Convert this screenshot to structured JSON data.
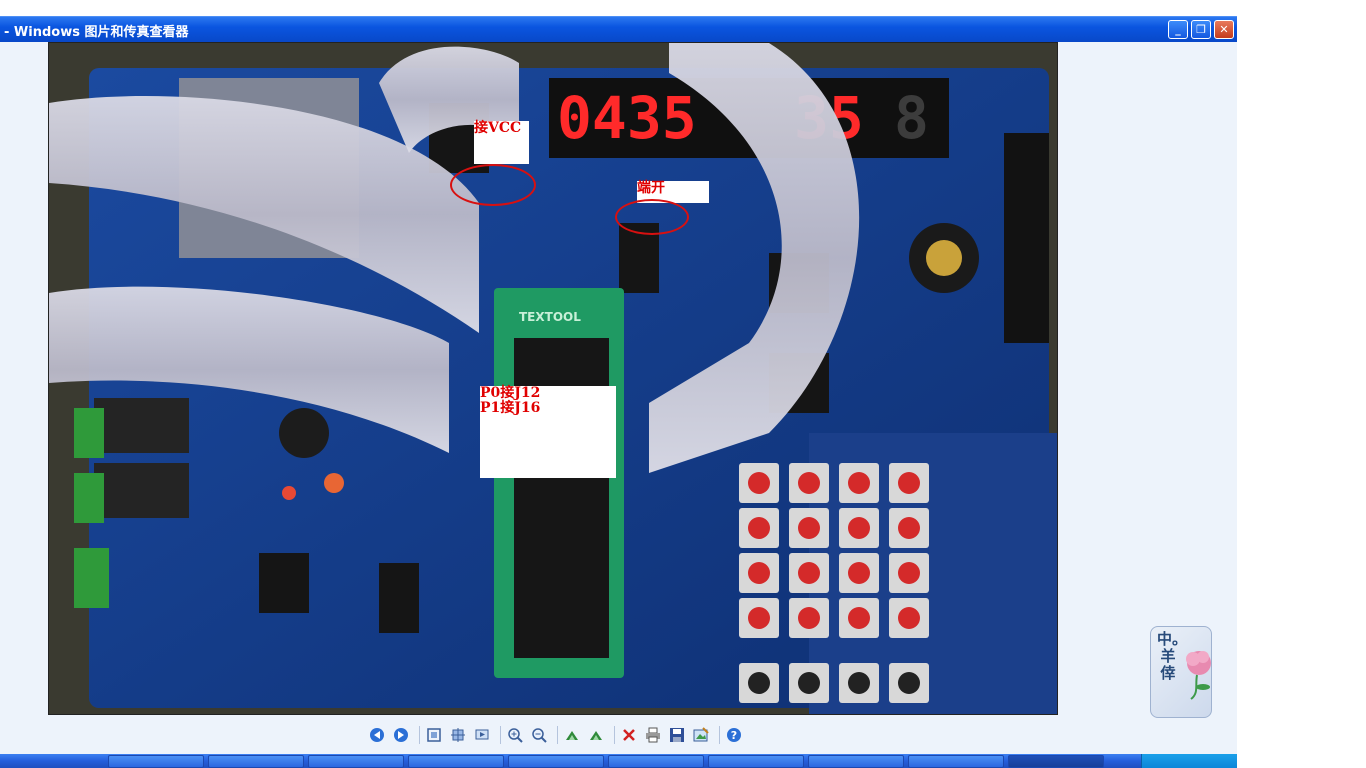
{
  "window": {
    "title": "- Windows 图片和传真查看器",
    "min_icon": "minimize-icon",
    "max_icon": "maximize-icon",
    "close_icon": "close-icon"
  },
  "photo": {
    "description_icon": "development-board-photo",
    "annotations": {
      "vcc": "接VCC",
      "disconnect": "端开",
      "p0": "P0接J12",
      "p1": "P1接J16"
    },
    "board_labels": {
      "seg_left": "0435",
      "seg_right": "35",
      "chip": "TEXTOOL"
    }
  },
  "toolbar": {
    "buttons": [
      {
        "name": "previous-image-button",
        "icon": "prev-icon"
      },
      {
        "name": "next-image-button",
        "icon": "next-icon"
      },
      {
        "name": "best-fit-button",
        "icon": "fit-icon"
      },
      {
        "name": "actual-size-button",
        "icon": "actual-size-icon"
      },
      {
        "name": "slideshow-button",
        "icon": "slideshow-icon"
      },
      {
        "name": "zoom-in-button",
        "icon": "zoom-in-icon"
      },
      {
        "name": "zoom-out-button",
        "icon": "zoom-out-icon"
      },
      {
        "name": "rotate-clockwise-button",
        "icon": "rotate-cw-icon"
      },
      {
        "name": "rotate-counterclockwise-button",
        "icon": "rotate-ccw-icon"
      },
      {
        "name": "delete-button",
        "icon": "delete-icon"
      },
      {
        "name": "print-button",
        "icon": "print-icon"
      },
      {
        "name": "save-button",
        "icon": "save-icon"
      },
      {
        "name": "edit-button",
        "icon": "edit-icon"
      },
      {
        "name": "help-button",
        "icon": "help-icon"
      }
    ]
  },
  "sticker": {
    "text": "中。羊倖"
  },
  "colors": {
    "accent": "#0a55e0",
    "annotation": "#e00000",
    "board": "#123a86"
  }
}
